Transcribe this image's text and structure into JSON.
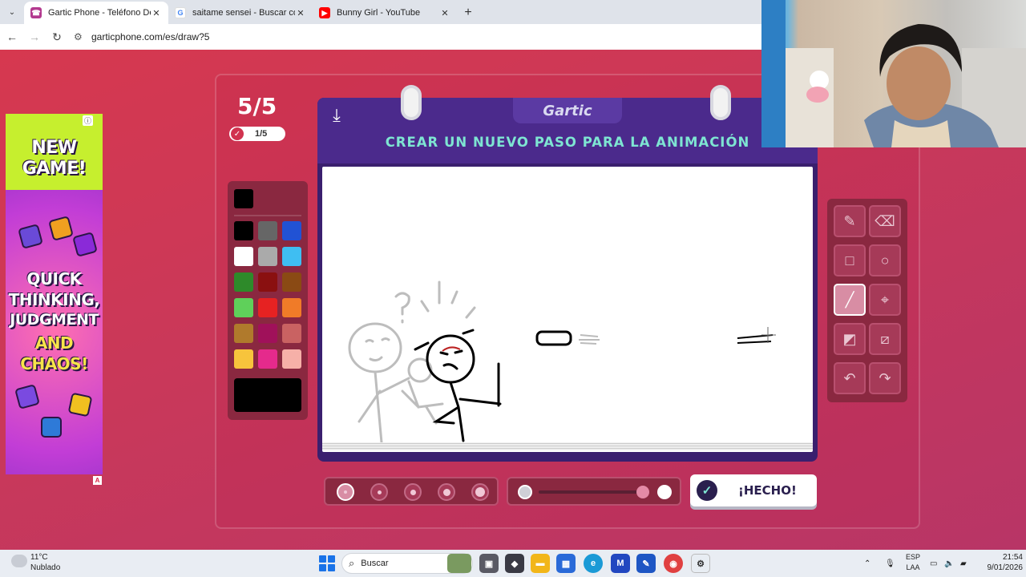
{
  "browser": {
    "tabs": [
      {
        "title": "Gartic Phone - Teléfono Descon",
        "active": true
      },
      {
        "title": "saitame sensei - Buscar con Go",
        "active": false
      },
      {
        "title": "Bunny Girl - YouTube",
        "active": false
      }
    ],
    "url": "garticphone.com/es/draw?5"
  },
  "game": {
    "round": "5/5",
    "done_count": "1/5",
    "brand": "Gartic",
    "prompt": "CREAR UN NUEVO PASO PARA LA ANIMACIÓN",
    "done_button": "¡HECHO!",
    "selected_color": "#000000",
    "palette": [
      "#000000",
      "#666666",
      "#2152d4",
      "#ffffff",
      "#aaaaaa",
      "#3fbef2",
      "#2e8a2a",
      "#8a1010",
      "#8a4a14",
      "#5fd05a",
      "#e62222",
      "#f07b28",
      "#b07a2c",
      "#a0115a",
      "#c96262",
      "#f7c43c",
      "#e52a8c",
      "#f6b0a8"
    ],
    "selected_brush_size_index": 0,
    "opacity_percent": 100
  },
  "ad": {
    "lines_top": [
      "NEW",
      "GAME!"
    ],
    "lines_bottom": [
      "QUICK",
      "THINKING,",
      "JUDGMENT",
      "AND",
      "CHAOS!"
    ]
  },
  "taskbar": {
    "weather_temp": "11°C",
    "weather_desc": "Nublado",
    "search": "Buscar",
    "lang_top": "ESP",
    "lang_bottom": "LAA",
    "time": "21:54",
    "date": "9/01/2026"
  }
}
